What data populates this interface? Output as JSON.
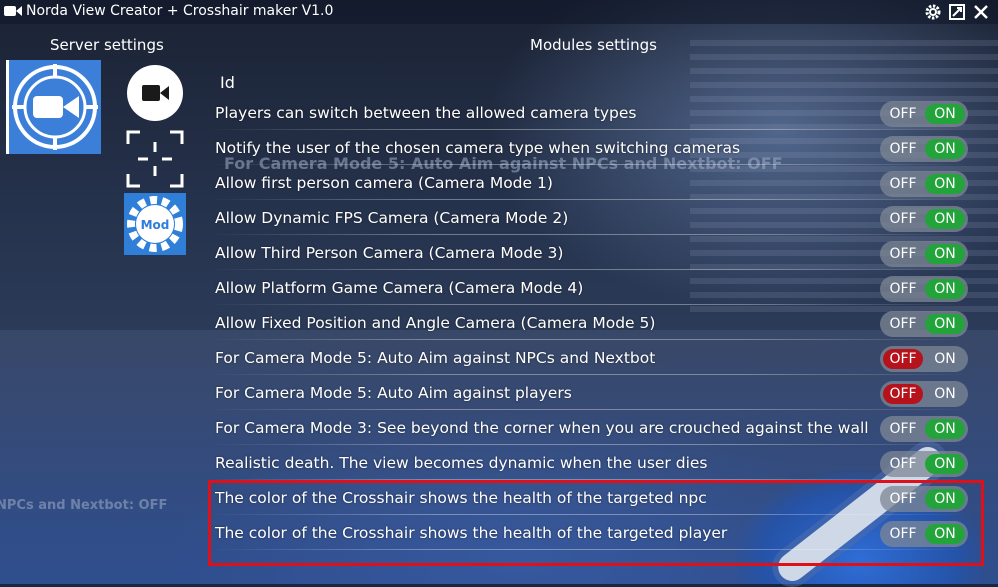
{
  "window": {
    "title": "Norda View Creator + Crosshair maker V1.0"
  },
  "headers": {
    "server": "Server settings",
    "modules": "Modules settings"
  },
  "sidebar": {
    "mod_label": "Mod"
  },
  "ghost_texts": [
    "For Camera Mode 5: Auto Aim against NPCs and Nextbot: OFF",
    "NPCs and Nextbot: OFF"
  ],
  "id_label": "Id",
  "toggle_labels": {
    "off": "OFF",
    "on": "ON"
  },
  "settings": [
    {
      "label": "Players can switch between the allowed camera types",
      "state": "on"
    },
    {
      "label": "Notify the user of the chosen camera type when switching cameras",
      "state": "on"
    },
    {
      "label": "Allow first person camera (Camera Mode 1)",
      "state": "on"
    },
    {
      "label": "Allow Dynamic FPS Camera (Camera Mode 2)",
      "state": "on"
    },
    {
      "label": "Allow Third Person Camera (Camera Mode 3)",
      "state": "on"
    },
    {
      "label": "Allow Platform Game Camera (Camera Mode 4)",
      "state": "on"
    },
    {
      "label": "Allow Fixed Position and Angle Camera (Camera Mode 5)",
      "state": "on"
    },
    {
      "label": "For Camera Mode 5: Auto Aim against NPCs and Nextbot",
      "state": "off"
    },
    {
      "label": "For Camera Mode 5: Auto Aim against players",
      "state": "off"
    },
    {
      "label": "For Camera Mode 3: See beyond the corner when you are crouched against the wall",
      "state": "on"
    },
    {
      "label": "Realistic death. The view becomes dynamic when the user dies",
      "state": "on"
    },
    {
      "label": "The color of the Crosshair shows the health of the targeted npc",
      "state": "on"
    },
    {
      "label": "The color of the Crosshair shows the health of the targeted player",
      "state": "on"
    }
  ],
  "colors": {
    "on_active": "#23a43a",
    "off_active": "#b5121b",
    "highlight_border": "#e0101a"
  },
  "icons": [
    "camera-icon",
    "settings-gear-icon",
    "fullscreen-icon",
    "close-icon",
    "view-creator-logo-icon",
    "camera-button-icon",
    "crosshair-icon",
    "mod-gear-icon"
  ]
}
